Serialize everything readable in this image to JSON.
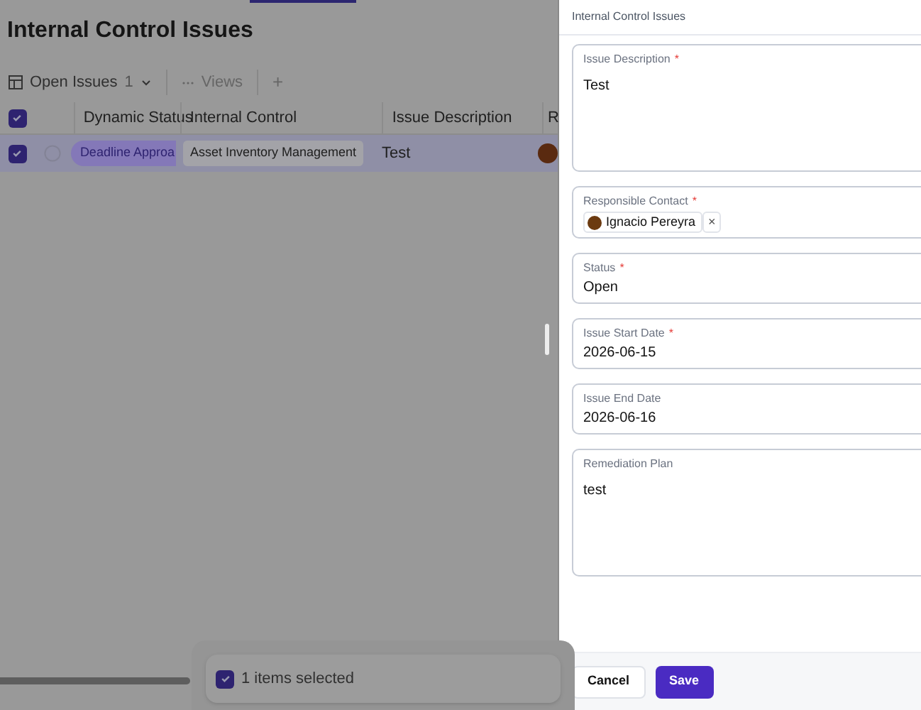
{
  "page": {
    "title": "Internal Control Issues"
  },
  "toolbar": {
    "view": {
      "label": "Open Issues",
      "count": "1"
    },
    "views": "Views",
    "add": "+"
  },
  "table": {
    "all_checked": true,
    "columns": [
      "Dynamic Status",
      "Internal Control",
      "Issue Description",
      "R"
    ],
    "rows": [
      {
        "checked": true,
        "selected": true,
        "status": "Deadline Approa",
        "control": "Asset Inventory Management",
        "description": "Test"
      }
    ]
  },
  "selection_bar": {
    "checked": true,
    "text": "1 items selected"
  },
  "panel": {
    "title": "Internal Control Issues",
    "fields": [
      {
        "kind": "textarea",
        "label": "Issue Description",
        "required_mark": "*",
        "value": "Test"
      },
      {
        "kind": "contact",
        "label": "Responsible Contact",
        "required_mark": "*",
        "value": "Ignacio Pereyra",
        "remove": "×"
      },
      {
        "kind": "text",
        "label": "Status",
        "required_mark": "*",
        "value": "Open"
      },
      {
        "kind": "text",
        "label": "Issue Start Date",
        "required_mark": "*",
        "value": "2026-06-15"
      },
      {
        "kind": "text",
        "label": "Issue End Date",
        "value": "2026-06-16"
      },
      {
        "kind": "textarea",
        "label": "Remediation Plan",
        "value": "test"
      }
    ],
    "buttons": {
      "cancel": "Cancel",
      "save": "Save"
    }
  }
}
